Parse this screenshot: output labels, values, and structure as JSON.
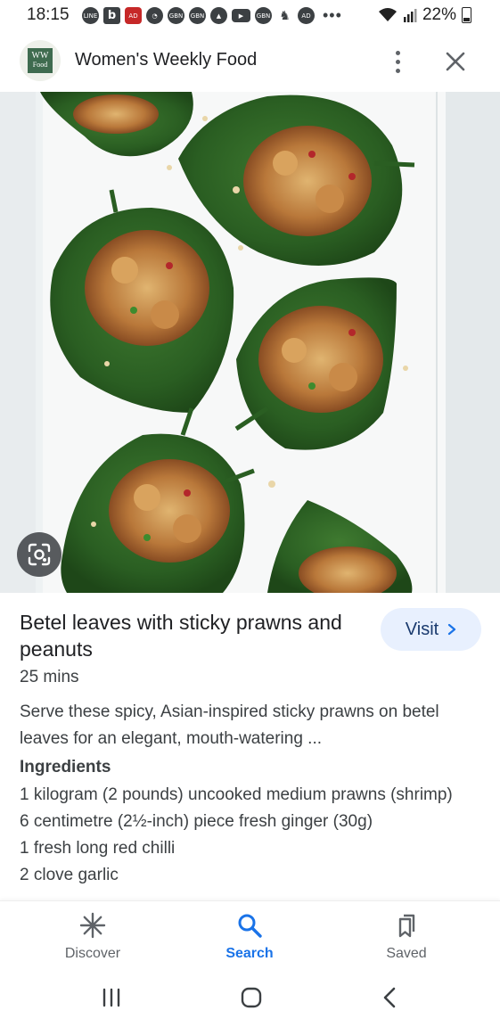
{
  "status_bar": {
    "time": "18:15",
    "battery": "22%",
    "icons": [
      "line-icon",
      "b-icon",
      "adblock-icon",
      "speed-icon",
      "gbn-icon",
      "gbn-icon",
      "navigation-icon",
      "youtube-icon",
      "gbn-icon",
      "cellist-icon",
      "adblock-icon"
    ],
    "icon_labels": {
      "line": "LINE",
      "b": "b",
      "ad": "AD",
      "gbn": "GBN"
    },
    "more": "•••"
  },
  "header": {
    "logo_text": [
      "WW",
      "Food"
    ],
    "title": "Women's Weekly Food"
  },
  "hero": {
    "description_icon": "betel-leaves-photo"
  },
  "recipe": {
    "title": "Betel leaves with sticky prawns and peanuts",
    "visit_label": "Visit",
    "duration": "25 mins",
    "description": "Serve these spicy, Asian-inspired sticky prawns on betel leaves for an elegant, mouth-watering ...",
    "ingredients_heading": "Ingredients",
    "ingredients": [
      "1 kilogram (2 pounds) uncooked medium prawns (shrimp)",
      "6 centimetre (2½-inch) piece fresh ginger (30g)",
      "1 fresh long red chilli",
      "2 clove garlic"
    ]
  },
  "bottom_nav": {
    "items": [
      {
        "label": "Discover",
        "icon": "discover-asterisk-icon"
      },
      {
        "label": "Search",
        "icon": "search-icon",
        "active": true
      },
      {
        "label": "Saved",
        "icon": "saved-bookmark-icon"
      }
    ]
  },
  "colors": {
    "accent": "#1a73e8",
    "visit_bg": "#e8f0fe",
    "text": "#202124",
    "secondary_text": "#3c4043"
  }
}
